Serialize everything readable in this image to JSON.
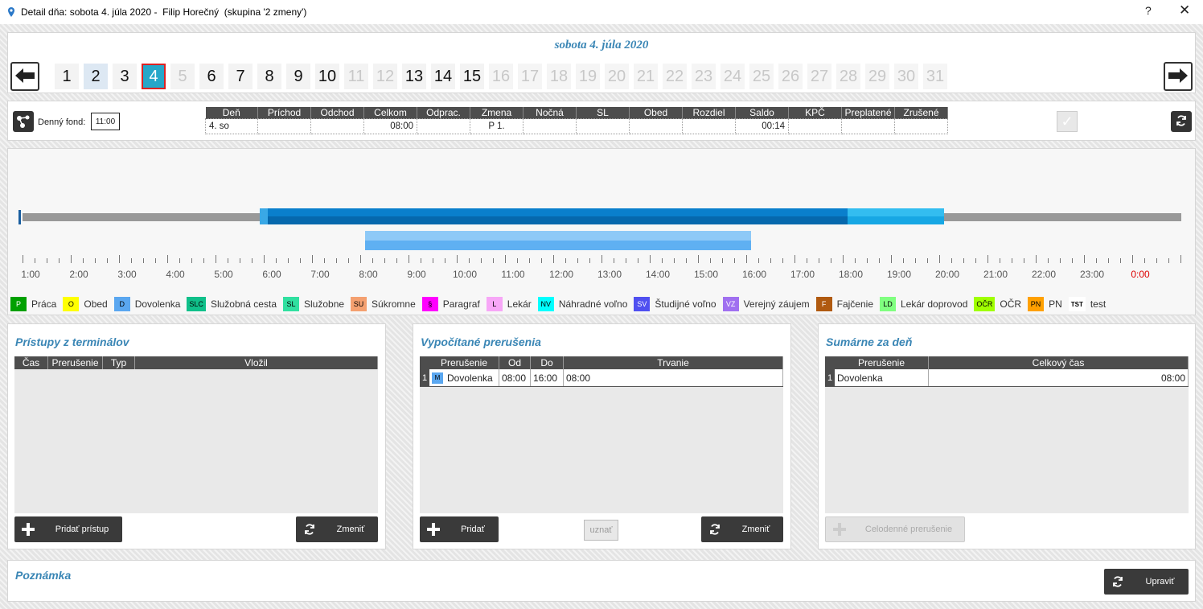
{
  "window": {
    "title": "Detail dňa: sobota 4. júla 2020 -  Filip Horečný  (skupina '2 zmeny')",
    "help": "?",
    "close": "✕"
  },
  "date_header": {
    "title": "sobota 4. júla 2020",
    "days": [
      "1",
      "2",
      "3",
      "4",
      "5",
      "6",
      "7",
      "8",
      "9",
      "10",
      "11",
      "12",
      "13",
      "14",
      "15",
      "16",
      "17",
      "18",
      "19",
      "20",
      "21",
      "22",
      "23",
      "24",
      "25",
      "26",
      "27",
      "28",
      "29",
      "30",
      "31"
    ]
  },
  "summary": {
    "fund_label": "Denný fond:",
    "fund_value": "11:00",
    "headers": [
      "Deň",
      "Príchod",
      "Odchod",
      "Celkom",
      "Odprac.",
      "Zmena",
      "Nočná",
      "SL",
      "Obed",
      "Rozdiel",
      "Saldo",
      "KPČ",
      "Preplatené",
      "Zrušené"
    ],
    "row": [
      "4. so",
      "",
      "",
      "08:00",
      "",
      "P 1.",
      "",
      "",
      "",
      "",
      "00:14",
      "",
      "",
      ""
    ]
  },
  "timeline": {
    "hours": [
      "1:00",
      "2:00",
      "3:00",
      "4:00",
      "5:00",
      "6:00",
      "7:00",
      "8:00",
      "9:00",
      "10:00",
      "11:00",
      "12:00",
      "13:00",
      "14:00",
      "15:00",
      "16:00",
      "17:00",
      "18:00",
      "19:00",
      "20:00",
      "21:00",
      "22:00",
      "23:00",
      "0:00"
    ],
    "legend": [
      {
        "code": "P",
        "label": "Práca",
        "color": "#00a000",
        "text": "#fff"
      },
      {
        "code": "O",
        "label": "Obed",
        "color": "#ffff00",
        "text": "#000"
      },
      {
        "code": "D",
        "label": "Dovolenka",
        "color": "#5aa7f0",
        "text": "#000"
      },
      {
        "code": "SLC",
        "label": "Služobná cesta",
        "color": "#10c08a",
        "text": "#000"
      },
      {
        "code": "SL",
        "label": "Služobne",
        "color": "#30e0a0",
        "text": "#000"
      },
      {
        "code": "SU",
        "label": "Súkromne",
        "color": "#f4a070",
        "text": "#000"
      },
      {
        "code": "§",
        "label": "Paragraf",
        "color": "#ff00ff",
        "text": "#000"
      },
      {
        "code": "L",
        "label": "Lekár",
        "color": "#f7a7f7",
        "text": "#000"
      },
      {
        "code": "NV",
        "label": "Náhradné voľno",
        "color": "#00ffff",
        "text": "#000"
      },
      {
        "code": "SV",
        "label": "Študijné voľno",
        "color": "#5050f0",
        "text": "#fff"
      },
      {
        "code": "VZ",
        "label": "Verejný záujem",
        "color": "#a070f0",
        "text": "#fff"
      },
      {
        "code": "F",
        "label": "Fajčenie",
        "color": "#b05a10",
        "text": "#fff"
      },
      {
        "code": "LD",
        "label": "Lekár doprovod",
        "color": "#80ff80",
        "text": "#000"
      },
      {
        "code": "OČR",
        "label": "OČR",
        "color": "#a0ff00",
        "text": "#000"
      },
      {
        "code": "PN",
        "label": "PN",
        "color": "#ffa000",
        "text": "#000"
      },
      {
        "code": "TST",
        "label": "test",
        "color": "#ffffff",
        "text": "#000"
      }
    ]
  },
  "access": {
    "title": "Prístupy z terminálov",
    "headers": [
      "Čas",
      "Prerušenie",
      "Typ",
      "Vložil"
    ],
    "add_label": "Pridať prístup",
    "change_label": "Zmeniť"
  },
  "breaks": {
    "title": "Vypočítané prerušenia",
    "headers": [
      "Prerušenie",
      "Od",
      "Do",
      "Trvanie"
    ],
    "rows": [
      {
        "num": "1",
        "badge": "M",
        "name": "Dovolenka",
        "from": "08:00",
        "to": "16:00",
        "duration": "08:00"
      }
    ],
    "add_label": "Pridať",
    "accept_label": "uznať",
    "change_label": "Zmeniť"
  },
  "totals": {
    "title": "Sumárne za deň",
    "headers": [
      "Prerušenie",
      "Celkový čas"
    ],
    "rows": [
      {
        "num": "1",
        "name": "Dovolenka",
        "total": "08:00"
      }
    ],
    "fullday_label": "Celodenné prerušenie"
  },
  "note": {
    "title": "Poznámka",
    "edit_label": "Upraviť"
  },
  "colors": {
    "accent": "#3a86b5",
    "selected_day": "#26a7c9",
    "work_bar": "#0a7fcc",
    "leave_bar": "#5fb0f2"
  }
}
